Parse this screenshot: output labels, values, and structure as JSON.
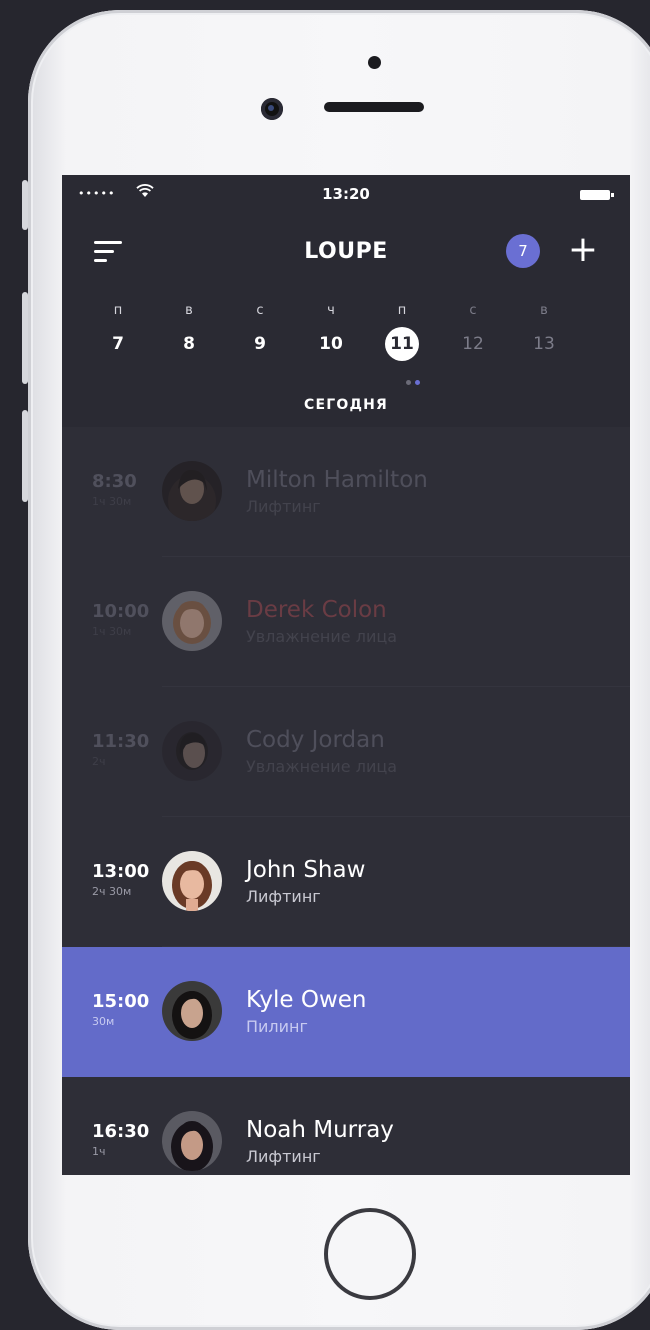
{
  "status": {
    "signal": "•••••",
    "time": "13:20"
  },
  "app": {
    "title": "LOUPE",
    "badge_count": "7",
    "add_label": "+"
  },
  "week": {
    "days": [
      {
        "name": "п",
        "date": "7"
      },
      {
        "name": "в",
        "date": "8"
      },
      {
        "name": "с",
        "date": "9"
      },
      {
        "name": "ч",
        "date": "10"
      },
      {
        "name": "п",
        "date": "11"
      },
      {
        "name": "с",
        "date": "12"
      },
      {
        "name": "в",
        "date": "13"
      }
    ],
    "selected_date": "11",
    "today_label": "СЕГОДНЯ"
  },
  "appointments": [
    {
      "time": "8:30",
      "duration": "1ч 30м",
      "name": "Milton Hamilton",
      "service": "Лифтинг",
      "state": "past"
    },
    {
      "time": "10:00",
      "duration": "1ч 30м",
      "name": "Derek Colon",
      "service": "Увлажнение лица",
      "state": "past",
      "name_color": "#6a3c44"
    },
    {
      "time": "11:30",
      "duration": "2ч",
      "name": "Cody Jordan",
      "service": "Увлажнение лица",
      "state": "past"
    },
    {
      "time": "13:00",
      "duration": "2ч 30м",
      "name": "John Shaw",
      "service": "Лифтинг",
      "state": "current"
    },
    {
      "time": "15:00",
      "duration": "30м",
      "name": "Kyle Owen",
      "service": "Пилинг",
      "state": "active"
    },
    {
      "time": "16:30",
      "duration": "1ч",
      "name": "Noah Murray",
      "service": "Лифтинг",
      "state": "current"
    }
  ],
  "colors": {
    "accent": "#636bc9",
    "badge": "#6a6fd3",
    "screen_bg": "#2e2e37",
    "header_bg": "#2a2a33"
  }
}
